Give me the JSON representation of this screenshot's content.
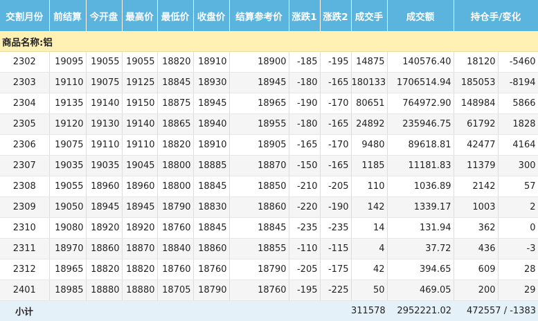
{
  "headers": [
    "交割月份",
    "前结算",
    "今开盘",
    "最高价",
    "最低价",
    "收盘价",
    "结算参考价",
    "涨跌1",
    "涨跌2",
    "成交手",
    "成交额",
    "持仓手",
    "变化"
  ],
  "section_label": "商品名称:铝",
  "rows": [
    [
      "2302",
      "19095",
      "19055",
      "19055",
      "18820",
      "18910",
      "18900",
      "-185",
      "-195",
      "14875",
      "140576.40",
      "18120",
      "-5460"
    ],
    [
      "2303",
      "19110",
      "19075",
      "19125",
      "18845",
      "18930",
      "18945",
      "-180",
      "-165",
      "180133",
      "1706514.94",
      "185053",
      "-8194"
    ],
    [
      "2304",
      "19135",
      "19140",
      "19150",
      "18875",
      "18945",
      "18965",
      "-190",
      "-170",
      "80651",
      "764972.90",
      "148984",
      "5866"
    ],
    [
      "2305",
      "19120",
      "19130",
      "19140",
      "18865",
      "18940",
      "18955",
      "-180",
      "-165",
      "24892",
      "235946.75",
      "61792",
      "1828"
    ],
    [
      "2306",
      "19075",
      "19110",
      "19110",
      "18820",
      "18910",
      "18905",
      "-165",
      "-170",
      "9480",
      "89618.81",
      "42477",
      "4164"
    ],
    [
      "2307",
      "19035",
      "19035",
      "19045",
      "18800",
      "18885",
      "18870",
      "-150",
      "-165",
      "1185",
      "11181.83",
      "11379",
      "300"
    ],
    [
      "2308",
      "19055",
      "18960",
      "18960",
      "18800",
      "18845",
      "18850",
      "-210",
      "-205",
      "110",
      "1036.89",
      "2142",
      "57"
    ],
    [
      "2309",
      "19050",
      "18945",
      "18945",
      "18790",
      "18830",
      "18860",
      "-220",
      "-190",
      "142",
      "1339.17",
      "1003",
      "2"
    ],
    [
      "2310",
      "19080",
      "18920",
      "18920",
      "18760",
      "18845",
      "18845",
      "-235",
      "-235",
      "14",
      "131.94",
      "362",
      "0"
    ],
    [
      "2311",
      "18970",
      "18860",
      "18870",
      "18840",
      "18860",
      "18855",
      "-110",
      "-115",
      "4",
      "37.72",
      "436",
      "-3"
    ],
    [
      "2312",
      "18965",
      "18820",
      "18820",
      "18760",
      "18760",
      "18790",
      "-205",
      "-175",
      "42",
      "394.65",
      "609",
      "28"
    ],
    [
      "2401",
      "18985",
      "18880",
      "18880",
      "18705",
      "18790",
      "18760",
      "-195",
      "-225",
      "50",
      "469.05",
      "200",
      "29"
    ]
  ],
  "subtotal": {
    "label": "小计",
    "volume": "311578",
    "turnover": "2952221.02",
    "open_interest_change": "472557 / -1383"
  }
}
